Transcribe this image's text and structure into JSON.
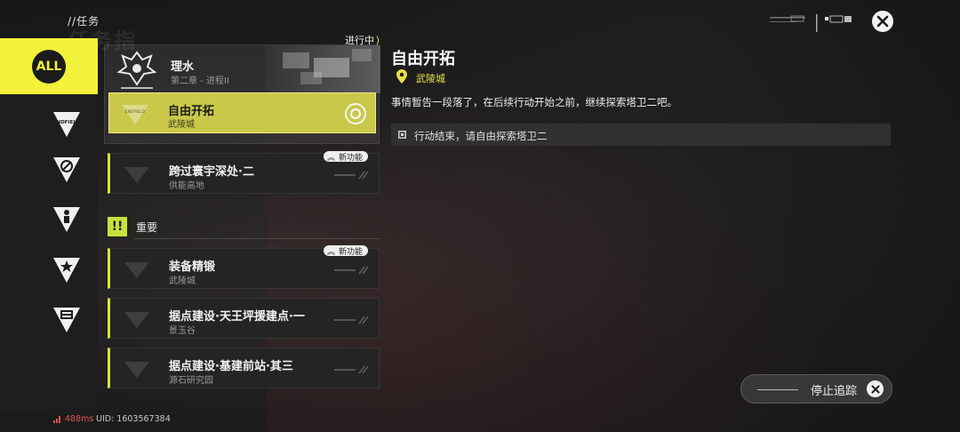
{
  "header": {
    "title": "//任务",
    "deco_text": "任务指"
  },
  "sidebar": {
    "items": [
      {
        "id": "all",
        "label": "ALL"
      },
      {
        "id": "endfield",
        "label": "ENDFIELD",
        "icon": "endfield-v-icon"
      },
      {
        "id": "faction",
        "label": "",
        "icon": "compass-triangle-icon"
      },
      {
        "id": "people",
        "label": "",
        "icon": "person-triangle-icon"
      },
      {
        "id": "star",
        "label": "",
        "icon": "star-triangle-icon"
      },
      {
        "id": "build",
        "label": "",
        "icon": "box-triangle-icon"
      }
    ]
  },
  "quests": {
    "status_tag": "进行中",
    "main_group": {
      "title": "理水",
      "subtitle": "第二章 - 进程II",
      "emblem_text": "ENDFIELD"
    },
    "active": {
      "title": "自由开拓",
      "location": "武陵城"
    },
    "list_top": [
      {
        "title": "跨过寰宇深处·二",
        "location": "供能高地",
        "badge": "新功能"
      }
    ],
    "important_label": "重要",
    "important_mark": "!!",
    "list_important": [
      {
        "title": "装备精锻",
        "location": "武陵城",
        "badge": "新功能"
      },
      {
        "title": "据点建设·天王坪援建点·一",
        "location": "景玉谷",
        "badge": ""
      },
      {
        "title": "据点建设·基建前站·其三",
        "location": "源石研究园",
        "badge": ""
      }
    ]
  },
  "detail": {
    "title": "自由开拓",
    "location": "武陵城",
    "description": "事情暂告一段落了，在后续行动开始之前，继续探索塔卫二吧。",
    "task": "行动结束，请自由探索塔卫二"
  },
  "actions": {
    "stop_tracking": "停止追踪"
  },
  "footer": {
    "ping": "488ms",
    "uid": "UID: 1603567384"
  },
  "colors": {
    "accent_yellow": "#f2f23a",
    "accent_green": "#c7e23c",
    "ping_red": "#e05252"
  }
}
